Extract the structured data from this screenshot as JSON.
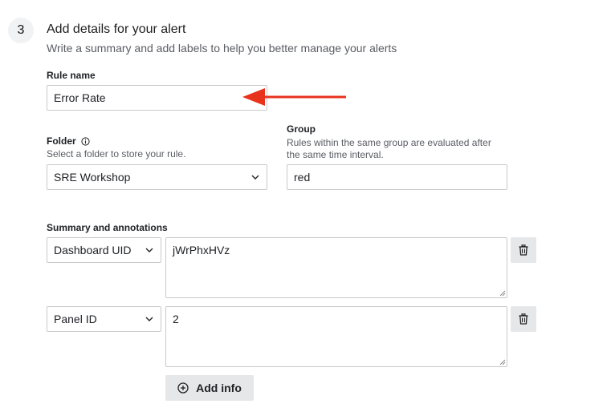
{
  "step": {
    "number": "3",
    "title": "Add details for your alert",
    "subtitle": "Write a summary and add labels to help you better manage your alerts"
  },
  "rule_name": {
    "label": "Rule name",
    "value": "Error Rate"
  },
  "folder": {
    "label": "Folder",
    "description": "Select a folder to store your rule.",
    "value": "SRE Workshop"
  },
  "group": {
    "label": "Group",
    "description_line1": "Rules within the same group are evaluated after",
    "description_line2": "the same time interval.",
    "value": "red"
  },
  "annotations": {
    "label": "Summary and annotations",
    "rows": [
      {
        "key": "Dashboard UID",
        "value": "jWrPhxHVz"
      },
      {
        "key": "Panel ID",
        "value": "2"
      }
    ],
    "add_label": "Add info"
  },
  "colors": {
    "arrow": "#e8321c"
  },
  "icons": {
    "info": "info-circle-icon",
    "chevron": "chevron-down-icon",
    "trash": "trash-icon",
    "add": "plus-circle-icon",
    "arrow": "red-arrow-icon"
  }
}
